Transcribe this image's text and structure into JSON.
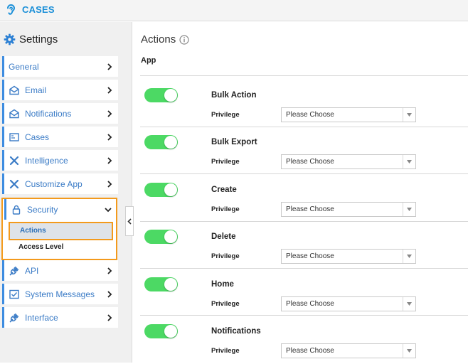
{
  "brand": {
    "name": "CASES",
    "icon": "ear-icon",
    "color": "#1a8fd8"
  },
  "sidebar": {
    "title": "Settings",
    "items": [
      {
        "label": "General",
        "icon": ""
      },
      {
        "label": "Email",
        "icon": "envelope-icon"
      },
      {
        "label": "Notifications",
        "icon": "envelope-open-icon"
      },
      {
        "label": "Cases",
        "icon": "cases-icon"
      },
      {
        "label": "Intelligence",
        "icon": "tools-icon"
      },
      {
        "label": "Customize App",
        "icon": "tools-icon"
      },
      {
        "label": "Security",
        "icon": "lock-icon",
        "expanded": true,
        "children": [
          {
            "label": "Actions",
            "selected": true
          },
          {
            "label": "Access Level"
          }
        ]
      },
      {
        "label": "API",
        "icon": "plug-icon"
      },
      {
        "label": "System Messages",
        "icon": "message-icon"
      },
      {
        "label": "Interface",
        "icon": "plug-icon"
      }
    ]
  },
  "main": {
    "title": "Actions",
    "section": "App",
    "privilege_label": "Privilege",
    "select_placeholder": "Please Choose",
    "rows": [
      {
        "name": "Bulk Action",
        "enabled": true
      },
      {
        "name": "Bulk Export",
        "enabled": true
      },
      {
        "name": "Create",
        "enabled": true
      },
      {
        "name": "Delete",
        "enabled": true
      },
      {
        "name": "Home",
        "enabled": true
      },
      {
        "name": "Notifications",
        "enabled": true
      }
    ]
  },
  "colors": {
    "accent": "#3d8ce0",
    "highlight": "#f39a1c",
    "toggle_on": "#4cd964",
    "link": "#3a7bc6"
  }
}
